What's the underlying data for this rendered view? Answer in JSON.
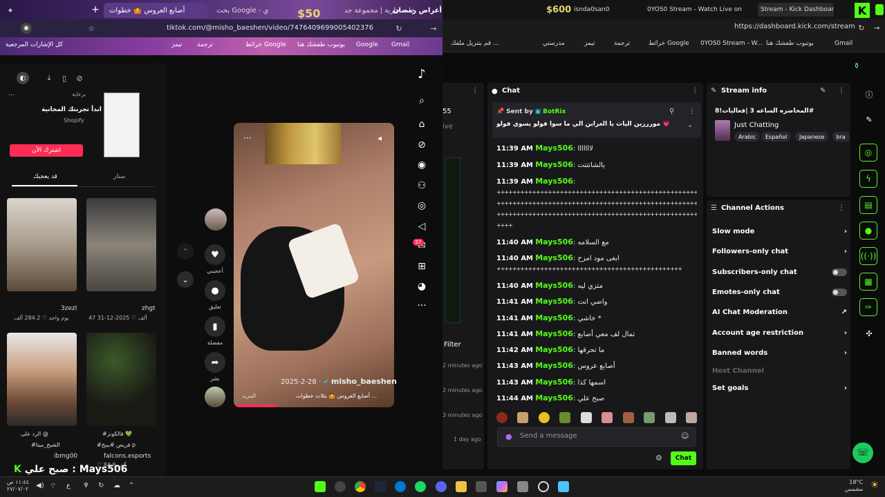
{
  "left_browser": {
    "tabs": [
      {
        "label": "أصابع العروس 🤷 خطوات"
      },
      {
        "label": "بحث Google - ي"
      },
      {
        "label": "جات جارية | مجموعة جد"
      },
      {
        "label": "شراء أغراض رمضان"
      }
    ],
    "price_badge": "$50",
    "url": "tiktok.com/@misho_baeshen/video/7476409699005402376",
    "bookmarks": [
      "كل الإشارات المرجعية",
      "يوتيوب",
      "ترجمة",
      "خرائط Google",
      "يوتيوب طفشك هنا",
      "Google",
      "Gmail",
      "تيمز"
    ]
  },
  "tiktok": {
    "ad": {
      "label": "برعاية",
      "text": "ابدأ تجربتك المجانية",
      "brand": "Shopify",
      "button": "اشترك الآن"
    },
    "tabs": [
      "قد يعجبك",
      "ستار"
    ],
    "thumbs": [
      {
        "author": "3zezl",
        "likes": "284.2 ألف",
        "date": "يوم واحد"
      },
      {
        "author": "zhgt",
        "likes": "47 ألف",
        "date": "2025-12-31"
      },
      {
        "author": "ibmg00",
        "likes": "",
        "date": "",
        "caption1": "الرد على @",
        "caption2": "#الشيخ_ميتا"
      },
      {
        "author": "falcons.esports",
        "likes": "84.9 ألف",
        "date": "",
        "caption1": "#فالكونز 💚",
        "caption2": "#فريص #ببيخ p"
      }
    ],
    "video": {
      "author": "misho_baeshen",
      "date": "2025-2-28",
      "caption": "أصابع العروس 🤷 بثلاث خطوات ...",
      "more": "المزيد"
    },
    "actions": [
      {
        "label": "أعجبني"
      },
      {
        "label": "تعليق"
      },
      {
        "label": "مفضلة"
      },
      {
        "label": "نشر"
      }
    ],
    "inbox_badge": "57",
    "overlay_text": "صبح علي : Mays506"
  },
  "right_browser": {
    "tabs": [
      {
        "label": "$600"
      },
      {
        "label": "isnda0san0"
      },
      {
        "label": "0YOS0 Stream - Watch Live on Kic"
      },
      {
        "label": "Stream - Kick Dashboard"
      }
    ],
    "url": "https://dashboard.kick.com/stream",
    "bookmarks": [
      "قم بتنزيل ملفك ...",
      "مدرستي",
      "تيمز",
      "ترجمة",
      "خرائط Google",
      "0YOS0 Stream - W...",
      "يوتيوب طفشك هنا",
      "Gmail"
    ]
  },
  "kick": {
    "left_partial": {
      "n": "55",
      "live": "ive",
      "filter": "Filter",
      "times": [
        "2 minutes ago",
        "2 minutes ago",
        "3 minutes ago",
        "1 day ago"
      ]
    },
    "chat": {
      "title": "Chat",
      "pinned": {
        "sent_by": "Sent by",
        "bot": "BotRix",
        "text": "مورررين الياث يا الغرابن الي ما سوا فولو يسوي فولو 💗"
      },
      "messages": [
        {
          "time": "11:39 AM",
          "user": "Mays506",
          "text": "لااااااا"
        },
        {
          "time": "11:39 AM",
          "user": "Mays506",
          "text": "يالشاتتتت"
        },
        {
          "time": "11:39 AM",
          "user": "Mays506",
          "text": ""
        },
        {
          "time": "11:40 AM",
          "user": "Mays506",
          "text": "مع السلامه"
        },
        {
          "time": "11:40 AM",
          "user": "Mays506",
          "text": "ابغى مود امزح"
        },
        {
          "time": "11:40 AM",
          "user": "Mays506",
          "text": "متزي ليه"
        },
        {
          "time": "11:41 AM",
          "user": "Mays506",
          "text": "واضي انت"
        },
        {
          "time": "11:41 AM",
          "user": "Mays506",
          "text": "خاشي *"
        },
        {
          "time": "11:41 AM",
          "user": "Mays506",
          "text": "تمال لف معي أصابع"
        },
        {
          "time": "11:42 AM",
          "user": "Mays506",
          "text": "ما تحرقها"
        },
        {
          "time": "11:43 AM",
          "user": "Mays506",
          "text": "أصابع عروس"
        },
        {
          "time": "11:43 AM",
          "user": "Mays506",
          "text": "اسمها كذا"
        },
        {
          "time": "11:44 AM",
          "user": "Mays506",
          "text": "صبح علي"
        }
      ],
      "plus_line": "++++++++++++++++++++++++++++++++++++++++++++++++++++++++++++",
      "placeholder": "Send a message",
      "send": "Chat"
    },
    "stream_info": {
      "title": "Stream info",
      "stream_title": "المحاضره الساعه 3 |فعاليات!8#",
      "category": "Just Chatting",
      "tags": [
        "Arabic",
        "Español",
        "Japanese",
        "bra"
      ]
    },
    "channel_actions": {
      "title": "Channel Actions",
      "items": [
        "Slow mode",
        "Followers-only chat",
        "Subscribers-only chat",
        "Emotes-only chat",
        "AI Chat Moderation",
        "Account age restriction",
        "Banned words",
        "Host Channel",
        "Set goals"
      ]
    }
  },
  "taskbar": {
    "weather": "18°C",
    "weather_desc": "مشمس",
    "clock": "١١:٤٤ ص",
    "date": "٢٧/٠٧/٠٢"
  },
  "colors": {
    "kick_green": "#53fc18",
    "tiktok_red": "#fe2c55"
  }
}
